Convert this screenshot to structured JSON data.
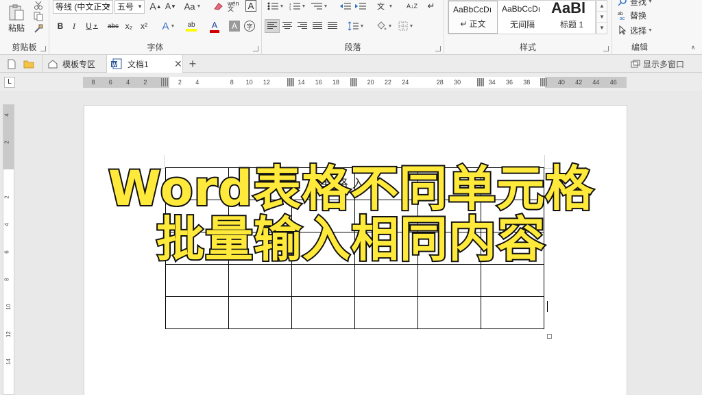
{
  "ribbon": {
    "clipboard": {
      "paste": "粘贴",
      "label": "剪贴板"
    },
    "font": {
      "font_name": "等线 (中文正文",
      "font_size": "五号",
      "grow": "A",
      "shrink": "A",
      "change_case": "Aa",
      "phonetic": "wén文",
      "border_char": "A",
      "bold": "B",
      "italic": "I",
      "underline": "U",
      "strike": "abc",
      "subscript": "x₂",
      "superscript": "x²",
      "text_effect": "A",
      "highlight": "ab",
      "font_color": "A",
      "char_shading": "A",
      "enclose": "字",
      "label": "字体",
      "font_color_hex": "#d00000",
      "highlight_hex": "#ffff00"
    },
    "paragraph": {
      "label": "段落",
      "sort": "A↓Z"
    },
    "styles": {
      "label": "样式",
      "items": [
        {
          "sample": "AaBbCcDı",
          "name": "↵ 正文"
        },
        {
          "sample": "AaBbCcDı",
          "name": "无间隔"
        },
        {
          "sample": "AaBl",
          "name": "标题 1"
        }
      ]
    },
    "editing": {
      "find": "查找",
      "replace": "替换",
      "select": "选择",
      "label": "编辑"
    }
  },
  "tabs": {
    "templates": "模板专区",
    "doc": "文档1",
    "add": "+",
    "multi_window": "显示多窗口"
  },
  "ruler": {
    "h_ticks": [
      "8",
      "6",
      "4",
      "2",
      "",
      "2",
      "4",
      "",
      "8",
      "10",
      "12",
      "",
      "14",
      "16",
      "18",
      "",
      "20",
      "22",
      "24",
      "",
      "28",
      "30",
      "",
      "34",
      "36",
      "38",
      "",
      "40",
      "42",
      "44",
      "46"
    ],
    "v_ticks": [
      "4",
      "2",
      "",
      "2",
      "4",
      "6",
      "8",
      "10",
      "12",
      "14"
    ]
  },
  "document": {
    "caption_partial": "单  格  入",
    "rows": 5,
    "cols": 6
  },
  "overlay": {
    "line1": "Word表格不同单元格",
    "line2": "批量输入相同内容",
    "color": "#ffea3b"
  }
}
